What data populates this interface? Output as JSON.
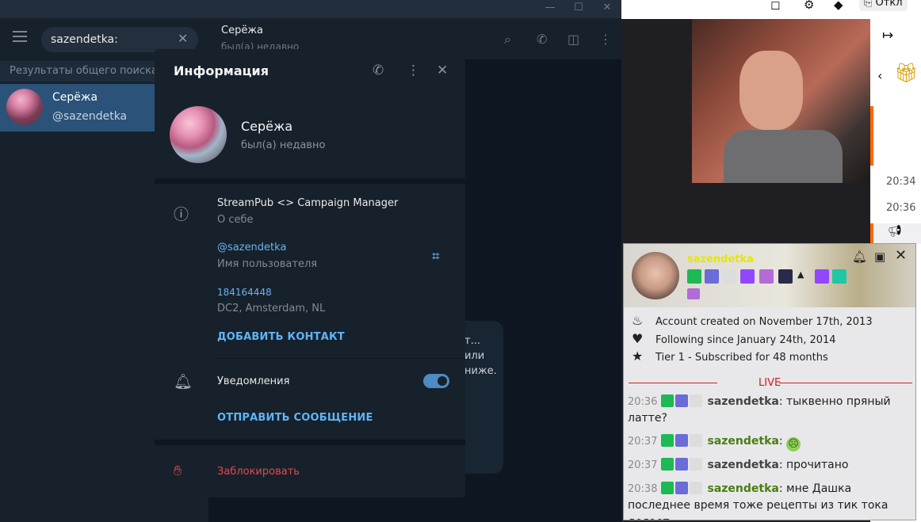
{
  "telegram": {
    "search": {
      "value": "sazendetka:"
    },
    "sidebar_header": "Результаты общего поиска",
    "result": {
      "name": "Серёжа",
      "username": "@sazendetka"
    },
    "chat_header": {
      "name": "Серёжа",
      "status": "был(а) недавно"
    },
    "bubble_text": "т...\nили\nниже."
  },
  "modal": {
    "title": "Информация",
    "profile": {
      "name": "Серёжа",
      "status": "был(а) недавно"
    },
    "bio": {
      "value": "StreamPub <> Campaign Manager",
      "label": "О себе"
    },
    "username": {
      "value": "@sazendetka",
      "label": "Имя пользователя"
    },
    "id": {
      "value": "184164448",
      "label": "DC2, Amsterdam, NL"
    },
    "add_contact": "ДОБАВИТЬ КОНТАКТ",
    "notifications": {
      "label": "Уведомления",
      "enabled": true
    },
    "send_message": "ОТПРАВИТЬ СООБЩЕНИЕ",
    "block": "Заблокировать"
  },
  "twitch_popup": {
    "username": "sazendetka",
    "account_created": "Account created on November 17th, 2013",
    "following": "Following since January 24th, 2014",
    "tier": "Tier 1 - Subscribed for 48 months",
    "live_label": "LIVE",
    "messages": [
      {
        "time": "20:36",
        "nick": "sazendetka",
        "text": ": тыквенно пряный латте?"
      },
      {
        "time": "20:37",
        "nick": "sazendetka",
        "text": ": "
      },
      {
        "time": "20:37",
        "nick": "sazendetka",
        "text": ": прочитано"
      },
      {
        "time": "20:38",
        "nick": "sazendetka",
        "text": ": мне Дашка последнее время тоже рецепты из тик тока делает"
      }
    ]
  },
  "twitch_side": {
    "times": [
      "20:34",
      "20:36"
    ],
    "topbar_label": "Откл"
  },
  "colors": {
    "accent": "#5eb5f7",
    "danger": "#e5484d",
    "live": "#c81e1e",
    "nick_green": "#4a7d12"
  }
}
